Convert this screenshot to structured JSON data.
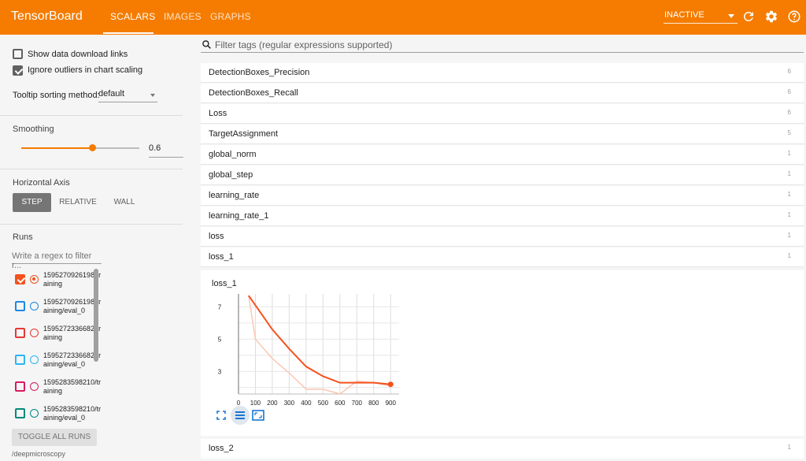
{
  "app": {
    "title": "TensorBoard",
    "tabs": [
      {
        "label": "SCALARS",
        "active": true
      },
      {
        "label": "IMAGES",
        "active": false
      },
      {
        "label": "GRAPHS",
        "active": false
      }
    ],
    "status": "INACTIVE",
    "accent": "#f57c00",
    "icons": [
      "refresh-icon",
      "settings-icon",
      "help-icon"
    ]
  },
  "sidebar": {
    "show_download": {
      "label": "Show data download links",
      "checked": false
    },
    "ignore_outliers": {
      "label": "Ignore outliers in chart scaling",
      "checked": true
    },
    "tooltip_sort": {
      "label": "Tooltip sorting method:",
      "value": "default"
    },
    "smoothing": {
      "title": "Smoothing",
      "value": "0.6",
      "fraction": 0.6
    },
    "horizontal_axis": {
      "title": "Horizontal Axis",
      "options": [
        {
          "label": "STEP",
          "active": true
        },
        {
          "label": "RELATIVE",
          "active": false
        },
        {
          "label": "WALL",
          "active": false
        }
      ]
    },
    "runs": {
      "title": "Runs",
      "filter_placeholder": "Write a regex to filter r...",
      "items": [
        {
          "label": "1595270926198/training",
          "color": "#f4511e",
          "checked": true,
          "selected": true
        },
        {
          "label": "1595270926198/training/eval_0",
          "color": "#1e88e5",
          "checked": false,
          "selected": false
        },
        {
          "label": "1595272336682/training",
          "color": "#e53935",
          "checked": false,
          "selected": false
        },
        {
          "label": "1595272336682/training/eval_0",
          "color": "#29b6f6",
          "checked": false,
          "selected": false
        },
        {
          "label": "1595283598210/training",
          "color": "#d81b60",
          "checked": false,
          "selected": false
        },
        {
          "label": "1595283598210/training/eval_0",
          "color": "#00897b",
          "checked": false,
          "selected": false
        }
      ],
      "toggle_label": "TOGGLE ALL RUNS",
      "logdir": "/deepmicroscopy"
    }
  },
  "main": {
    "filter_placeholder": "Filter tags (regular expressions supported)",
    "tags": [
      {
        "name": "DetectionBoxes_Precision",
        "count": "6"
      },
      {
        "name": "DetectionBoxes_Recall",
        "count": "6"
      },
      {
        "name": "Loss",
        "count": "6"
      },
      {
        "name": "TargetAssignment",
        "count": "5"
      },
      {
        "name": "global_norm",
        "count": "1"
      },
      {
        "name": "global_step",
        "count": "1"
      },
      {
        "name": "learning_rate",
        "count": "1"
      },
      {
        "name": "learning_rate_1",
        "count": "1"
      },
      {
        "name": "loss",
        "count": "1"
      },
      {
        "name": "loss_1",
        "count": "1"
      }
    ],
    "open_tag": {
      "name": "loss_2",
      "count": "1"
    }
  },
  "chart_data": {
    "type": "line",
    "title": "loss_1",
    "xlabel": "",
    "ylabel": "",
    "x_ticks": [
      "0",
      "100",
      "200",
      "300",
      "400",
      "500",
      "600",
      "700",
      "800",
      "900"
    ],
    "y_ticks": [
      "3",
      "5",
      "7"
    ],
    "xlim": [
      0,
      950
    ],
    "ylim": [
      1.6,
      7.8
    ],
    "grid": true,
    "series": [
      {
        "role": "raw",
        "color": "#fcc6b4",
        "x": [
          60,
          100,
          200,
          300,
          400,
          500,
          600,
          700,
          800,
          900
        ],
        "y": [
          7.7,
          5.0,
          3.8,
          2.9,
          1.9,
          1.9,
          1.6,
          2.4,
          2.3,
          2.1
        ]
      },
      {
        "role": "smoothed",
        "color": "#f4511e",
        "x": [
          60,
          100,
          200,
          300,
          400,
          500,
          600,
          700,
          800,
          900
        ],
        "y": [
          7.7,
          7.1,
          5.6,
          4.4,
          3.3,
          2.7,
          2.3,
          2.3,
          2.3,
          2.2
        ]
      }
    ]
  }
}
